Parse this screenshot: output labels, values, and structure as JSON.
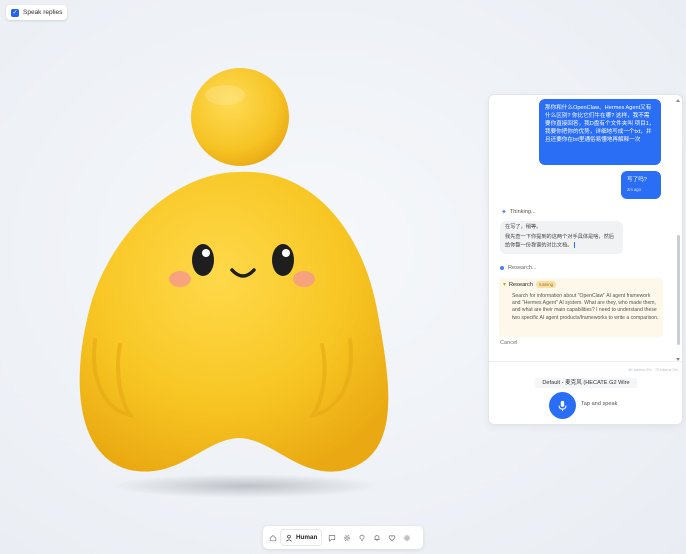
{
  "speak_toggle": {
    "label": "Speak replies",
    "checked": true
  },
  "chat": {
    "messages": [
      {
        "role": "user",
        "text": "那你和什么OpenClaw、Hermes Agent又有什么区别? 你比它们牛在哪? 这样，我不需要你直接回答，我D盘有个文件夹叫 项目1，我要你把你的优势，详细地写成一个txt，并且还要你在txt里通俗易懂地再解释一次"
      },
      {
        "role": "user",
        "text": "写了吗?",
        "time": "2m ago"
      }
    ],
    "thinking_label": "Thinking...",
    "ai_reply": {
      "line1": "在写了，稍等。",
      "line2": "我先查一下你提到的这两个对手具体是啥，然后给你整一份靠谱的对比文档。"
    },
    "researching_label": "Research...",
    "research": {
      "title": "Research",
      "badge": "running",
      "body": "Search for information about \"OpenClaw\" AI agent framework and \"Hermes Agent\" AI system. What are they, who made them, and what are their main capabilities? I need to understand these two specific AI agent products/frameworks to write a comparison."
    },
    "cancel_label": "Cancel",
    "usage": "4K tokens 0% · 70 tokens 0%"
  },
  "voice": {
    "label": "Default - 麦克风 (HECATE G2 Wire",
    "tap_label": "Tap and speak"
  },
  "toolbar": {
    "active_label": "Human",
    "icons": [
      "home-icon",
      "human-icon",
      "chat-icon",
      "settings-cog-icon",
      "lightbulb-icon",
      "bell-icon",
      "heart-icon",
      "gear-icon"
    ]
  },
  "colors": {
    "accent": "#2b6ef6",
    "mascot_yellow": "#f7c623",
    "research_bg": "#fdf8ea",
    "badge_bg": "#f8e1a8"
  }
}
